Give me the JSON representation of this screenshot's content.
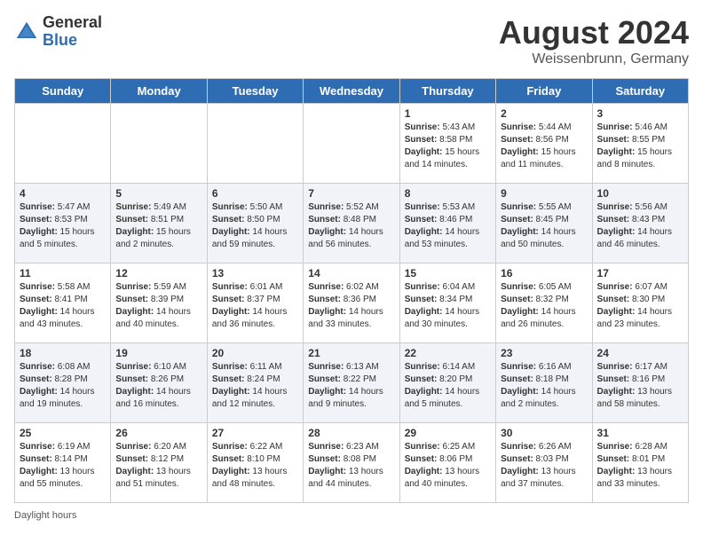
{
  "header": {
    "logo_general": "General",
    "logo_blue": "Blue",
    "month_title": "August 2024",
    "location": "Weissenbrunn, Germany"
  },
  "days_of_week": [
    "Sunday",
    "Monday",
    "Tuesday",
    "Wednesday",
    "Thursday",
    "Friday",
    "Saturday"
  ],
  "weeks": [
    [
      {
        "day": "",
        "info": ""
      },
      {
        "day": "",
        "info": ""
      },
      {
        "day": "",
        "info": ""
      },
      {
        "day": "",
        "info": ""
      },
      {
        "day": "1",
        "info": "Sunrise: 5:43 AM\nSunset: 8:58 PM\nDaylight: 15 hours and 14 minutes."
      },
      {
        "day": "2",
        "info": "Sunrise: 5:44 AM\nSunset: 8:56 PM\nDaylight: 15 hours and 11 minutes."
      },
      {
        "day": "3",
        "info": "Sunrise: 5:46 AM\nSunset: 8:55 PM\nDaylight: 15 hours and 8 minutes."
      }
    ],
    [
      {
        "day": "4",
        "info": "Sunrise: 5:47 AM\nSunset: 8:53 PM\nDaylight: 15 hours and 5 minutes."
      },
      {
        "day": "5",
        "info": "Sunrise: 5:49 AM\nSunset: 8:51 PM\nDaylight: 15 hours and 2 minutes."
      },
      {
        "day": "6",
        "info": "Sunrise: 5:50 AM\nSunset: 8:50 PM\nDaylight: 14 hours and 59 minutes."
      },
      {
        "day": "7",
        "info": "Sunrise: 5:52 AM\nSunset: 8:48 PM\nDaylight: 14 hours and 56 minutes."
      },
      {
        "day": "8",
        "info": "Sunrise: 5:53 AM\nSunset: 8:46 PM\nDaylight: 14 hours and 53 minutes."
      },
      {
        "day": "9",
        "info": "Sunrise: 5:55 AM\nSunset: 8:45 PM\nDaylight: 14 hours and 50 minutes."
      },
      {
        "day": "10",
        "info": "Sunrise: 5:56 AM\nSunset: 8:43 PM\nDaylight: 14 hours and 46 minutes."
      }
    ],
    [
      {
        "day": "11",
        "info": "Sunrise: 5:58 AM\nSunset: 8:41 PM\nDaylight: 14 hours and 43 minutes."
      },
      {
        "day": "12",
        "info": "Sunrise: 5:59 AM\nSunset: 8:39 PM\nDaylight: 14 hours and 40 minutes."
      },
      {
        "day": "13",
        "info": "Sunrise: 6:01 AM\nSunset: 8:37 PM\nDaylight: 14 hours and 36 minutes."
      },
      {
        "day": "14",
        "info": "Sunrise: 6:02 AM\nSunset: 8:36 PM\nDaylight: 14 hours and 33 minutes."
      },
      {
        "day": "15",
        "info": "Sunrise: 6:04 AM\nSunset: 8:34 PM\nDaylight: 14 hours and 30 minutes."
      },
      {
        "day": "16",
        "info": "Sunrise: 6:05 AM\nSunset: 8:32 PM\nDaylight: 14 hours and 26 minutes."
      },
      {
        "day": "17",
        "info": "Sunrise: 6:07 AM\nSunset: 8:30 PM\nDaylight: 14 hours and 23 minutes."
      }
    ],
    [
      {
        "day": "18",
        "info": "Sunrise: 6:08 AM\nSunset: 8:28 PM\nDaylight: 14 hours and 19 minutes."
      },
      {
        "day": "19",
        "info": "Sunrise: 6:10 AM\nSunset: 8:26 PM\nDaylight: 14 hours and 16 minutes."
      },
      {
        "day": "20",
        "info": "Sunrise: 6:11 AM\nSunset: 8:24 PM\nDaylight: 14 hours and 12 minutes."
      },
      {
        "day": "21",
        "info": "Sunrise: 6:13 AM\nSunset: 8:22 PM\nDaylight: 14 hours and 9 minutes."
      },
      {
        "day": "22",
        "info": "Sunrise: 6:14 AM\nSunset: 8:20 PM\nDaylight: 14 hours and 5 minutes."
      },
      {
        "day": "23",
        "info": "Sunrise: 6:16 AM\nSunset: 8:18 PM\nDaylight: 14 hours and 2 minutes."
      },
      {
        "day": "24",
        "info": "Sunrise: 6:17 AM\nSunset: 8:16 PM\nDaylight: 13 hours and 58 minutes."
      }
    ],
    [
      {
        "day": "25",
        "info": "Sunrise: 6:19 AM\nSunset: 8:14 PM\nDaylight: 13 hours and 55 minutes."
      },
      {
        "day": "26",
        "info": "Sunrise: 6:20 AM\nSunset: 8:12 PM\nDaylight: 13 hours and 51 minutes."
      },
      {
        "day": "27",
        "info": "Sunrise: 6:22 AM\nSunset: 8:10 PM\nDaylight: 13 hours and 48 minutes."
      },
      {
        "day": "28",
        "info": "Sunrise: 6:23 AM\nSunset: 8:08 PM\nDaylight: 13 hours and 44 minutes."
      },
      {
        "day": "29",
        "info": "Sunrise: 6:25 AM\nSunset: 8:06 PM\nDaylight: 13 hours and 40 minutes."
      },
      {
        "day": "30",
        "info": "Sunrise: 6:26 AM\nSunset: 8:03 PM\nDaylight: 13 hours and 37 minutes."
      },
      {
        "day": "31",
        "info": "Sunrise: 6:28 AM\nSunset: 8:01 PM\nDaylight: 13 hours and 33 minutes."
      }
    ]
  ],
  "legend": "Daylight hours"
}
